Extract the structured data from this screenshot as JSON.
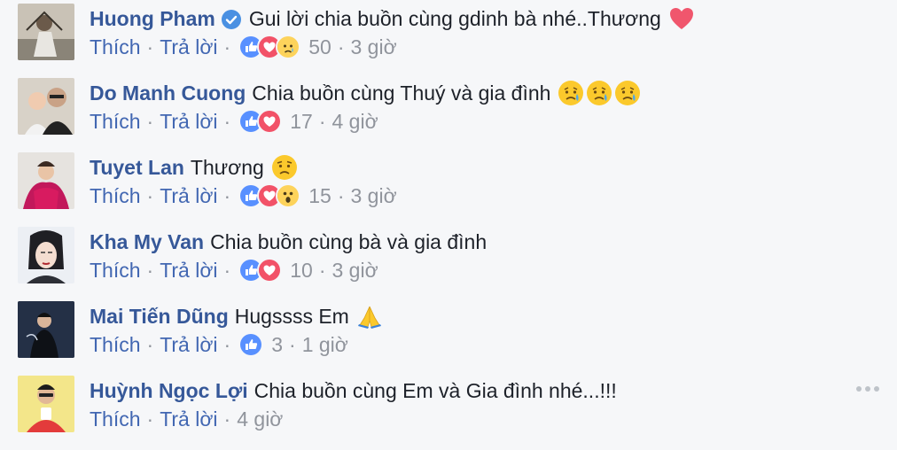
{
  "actions": {
    "like": "Thích",
    "reply": "Trả lời",
    "separator": "·"
  },
  "comments": [
    {
      "author": "Huong Pham",
      "verified": true,
      "text": "Gui lời chia buồn cùng gdinh bà nhé..Thương",
      "emojis": [
        "heart"
      ],
      "reactions": [
        "like",
        "love",
        "sad"
      ],
      "count": "50",
      "time": "3 giờ"
    },
    {
      "author": "Do Manh Cuong",
      "verified": false,
      "text": "Chia buồn cùng Thuý và gia đình",
      "emojis": [
        "sad-tear",
        "sad-tear",
        "sad-tear"
      ],
      "reactions": [
        "like",
        "love"
      ],
      "count": "17",
      "time": "4 giờ"
    },
    {
      "author": "Tuyet Lan",
      "verified": false,
      "text": "Thương",
      "emojis": [
        "worried"
      ],
      "reactions": [
        "like",
        "love",
        "wow"
      ],
      "count": "15",
      "time": "3 giờ"
    },
    {
      "author": "Kha My Van",
      "verified": false,
      "text": "Chia buồn cùng bà và gia đình",
      "emojis": [],
      "reactions": [
        "like",
        "love"
      ],
      "count": "10",
      "time": "3 giờ"
    },
    {
      "author": "Mai Tiến Dũng",
      "verified": false,
      "text": "Hugssss Em",
      "emojis": [
        "folded-hands"
      ],
      "reactions": [
        "like"
      ],
      "count": "3",
      "time": "1 giờ"
    },
    {
      "author": "Huỳnh Ngọc Lợi",
      "verified": false,
      "text": "Chia buồn cùng Em và Gia đình nhé...!!!",
      "emojis": [],
      "reactions": [],
      "count": "",
      "time": "4 giờ"
    }
  ],
  "colors": {
    "name": "#365899",
    "link": "#4267b2",
    "meta": "#90949c",
    "like": "#5890ff",
    "love": "#f25268"
  }
}
